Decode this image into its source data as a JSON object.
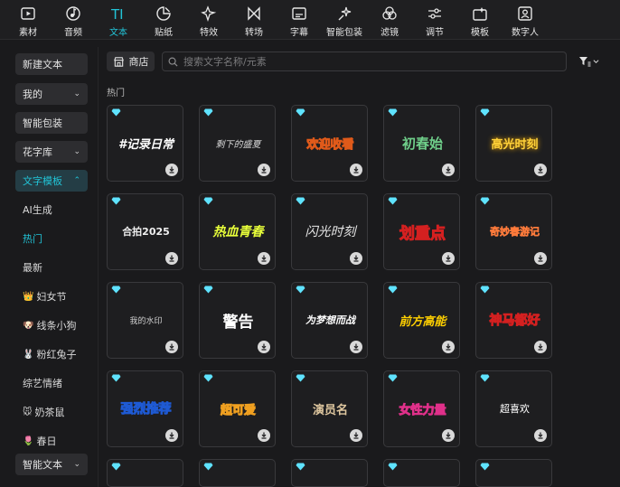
{
  "toolbar": {
    "items": [
      {
        "label": "素材",
        "icon": "media-play-icon"
      },
      {
        "label": "音频",
        "icon": "music-note-icon"
      },
      {
        "label": "文本",
        "icon": "text-ti-icon",
        "active": true
      },
      {
        "label": "贴纸",
        "icon": "sticker-icon"
      },
      {
        "label": "特效",
        "icon": "sparkle-star-icon"
      },
      {
        "label": "转场",
        "icon": "bowtie-transition-icon"
      },
      {
        "label": "字幕",
        "icon": "subtitle-box-icon"
      },
      {
        "label": "智能包装",
        "icon": "magic-sparkle-icon"
      },
      {
        "label": "滤镜",
        "icon": "filter-circles-icon"
      },
      {
        "label": "调节",
        "icon": "adjust-sliders-icon"
      },
      {
        "label": "模板",
        "icon": "template-icon"
      },
      {
        "label": "数字人",
        "icon": "digital-human-icon"
      }
    ],
    "accent": "#22c3d6"
  },
  "sidebar": {
    "new_text": "新建文本",
    "mine": "我的",
    "smart_pack": "智能包装",
    "flower_font": "花字库",
    "text_template": "文字模板",
    "items": [
      {
        "label": "AI生成"
      },
      {
        "label": "热门",
        "active": true
      },
      {
        "label": "最新"
      },
      {
        "label": "妇女节",
        "emoji": "👑"
      },
      {
        "label": "线条小狗",
        "emoji": "🐶"
      },
      {
        "label": "粉红兔子",
        "emoji": "🐰"
      },
      {
        "label": "综艺情绪"
      },
      {
        "label": "奶茶鼠",
        "emoji": "🐭"
      },
      {
        "label": "春日",
        "emoji": "🌷"
      }
    ],
    "smart_text": "智能文本"
  },
  "search": {
    "store_label": "商店",
    "placeholder": "搜索文字名称/元素"
  },
  "section_title": "热门",
  "templates": [
    {
      "text": "#记录日常",
      "color": "#ffffff"
    },
    {
      "text": "剩下的盛夏",
      "color": "#d8d8d8"
    },
    {
      "text": "欢迎收看",
      "color": "#ffffff"
    },
    {
      "text": "初春始",
      "color": "#6fcf8a"
    },
    {
      "text": "高光时刻",
      "color": "#ffd23a"
    },
    {
      "text": "合拍2025",
      "color": "#f0f0f0"
    },
    {
      "text": "热血青春",
      "color": "#e8ff3a"
    },
    {
      "text": "闪光时刻",
      "color": "#e6e6e6"
    },
    {
      "text": "划重点",
      "color": "#ffd000"
    },
    {
      "text": "奇妙春游记",
      "color": "#ffffff"
    },
    {
      "text": "我的水印",
      "color": "#cfcfcf"
    },
    {
      "text": "警告",
      "color": "#ffffff"
    },
    {
      "text": "为梦想而战",
      "color": "#ffffff"
    },
    {
      "text": "前方高能",
      "color": "#ffd000"
    },
    {
      "text": "神马都好",
      "color": "#ffffff"
    },
    {
      "text": "强烈推荐",
      "color": "#ffe000"
    },
    {
      "text": "超可爱",
      "color": "#ffffff"
    },
    {
      "text": "演员名",
      "color": "#e0c8a0"
    },
    {
      "text": "女性力量",
      "color": "#ffffff"
    },
    {
      "text": "超喜欢",
      "color": "#ffffff"
    },
    {
      "text": "",
      "color": "#ffffff"
    },
    {
      "text": "",
      "color": "#ffffff"
    },
    {
      "text": "",
      "color": "#ffffff"
    },
    {
      "text": "",
      "color": "#ffffff"
    },
    {
      "text": "",
      "color": "#ffffff"
    }
  ]
}
